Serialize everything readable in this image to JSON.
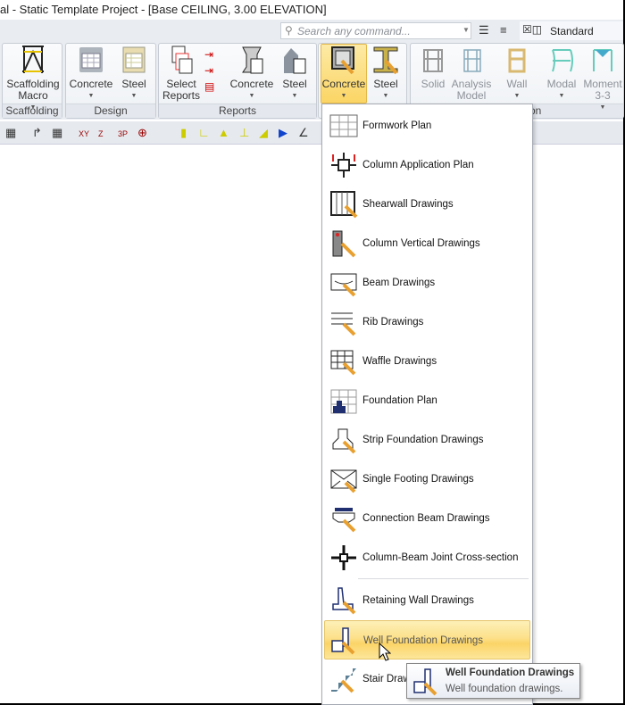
{
  "window": {
    "title": "al - Static Template Project - [Base CEILING,  3.00 ELEVATION]"
  },
  "quick": {
    "search_placeholder": "Search any command...",
    "workspace": "Standard"
  },
  "ribbon": {
    "groups": [
      {
        "label": "Scaffolding",
        "buttons": [
          {
            "label": "Scaffolding Macro",
            "icon": "scaffolding-icon"
          }
        ]
      },
      {
        "label": "Design",
        "buttons": [
          {
            "label": "Concrete",
            "icon": "concrete-design-icon"
          },
          {
            "label": "Steel",
            "icon": "steel-design-icon"
          }
        ]
      },
      {
        "label": "Reports",
        "buttons": [
          {
            "label": "Select Reports",
            "icon": "select-reports-icon"
          },
          {
            "label": "Concrete",
            "icon": "concrete-report-icon"
          },
          {
            "label": "Steel",
            "icon": "steel-report-icon"
          }
        ]
      },
      {
        "label": "",
        "buttons": [
          {
            "label": "Concrete",
            "icon": "concrete-drawing-icon",
            "active": true
          },
          {
            "label": "Steel",
            "icon": "steel-drawing-icon"
          }
        ]
      },
      {
        "label": "Inspection",
        "buttons": [
          {
            "label": "Solid",
            "icon": "solid-icon"
          },
          {
            "label": "Analysis Model",
            "icon": "analysis-model-icon"
          },
          {
            "label": "Wall",
            "icon": "wall-icon"
          },
          {
            "label": "Modal",
            "icon": "modal-icon"
          },
          {
            "label": "Moment 3-3",
            "icon": "moment-icon"
          }
        ]
      }
    ]
  },
  "menu": {
    "items": [
      {
        "label": "Formwork Plan",
        "icon": "formwork-plan-icon"
      },
      {
        "label": "Column Application Plan",
        "icon": "column-application-icon"
      },
      {
        "label": "Shearwall Drawings",
        "icon": "shearwall-icon"
      },
      {
        "label": "Column Vertical Drawings",
        "icon": "column-vertical-icon"
      },
      {
        "label": "Beam Drawings",
        "icon": "beam-icon"
      },
      {
        "label": "Rib Drawings",
        "icon": "rib-icon"
      },
      {
        "label": "Waffle Drawings",
        "icon": "waffle-icon"
      },
      {
        "label": "Foundation Plan",
        "icon": "foundation-plan-icon"
      },
      {
        "label": "Strip Foundation Drawings",
        "icon": "strip-foundation-icon"
      },
      {
        "label": "Single Footing Drawings",
        "icon": "single-footing-icon"
      },
      {
        "label": "Connection Beam Drawings",
        "icon": "connection-beam-icon"
      },
      {
        "label": "Column-Beam Joint Cross-section",
        "icon": "joint-icon"
      },
      {
        "label": "Retaining Wall Drawings",
        "icon": "retaining-wall-icon"
      },
      {
        "label": "Well Foundation Drawings",
        "icon": "well-foundation-icon",
        "highlighted": true
      },
      {
        "label": "Stair Drawings",
        "icon": "stair-icon"
      }
    ]
  },
  "tooltip": {
    "title": "Well Foundation Drawings",
    "description": "Well foundation drawings."
  }
}
